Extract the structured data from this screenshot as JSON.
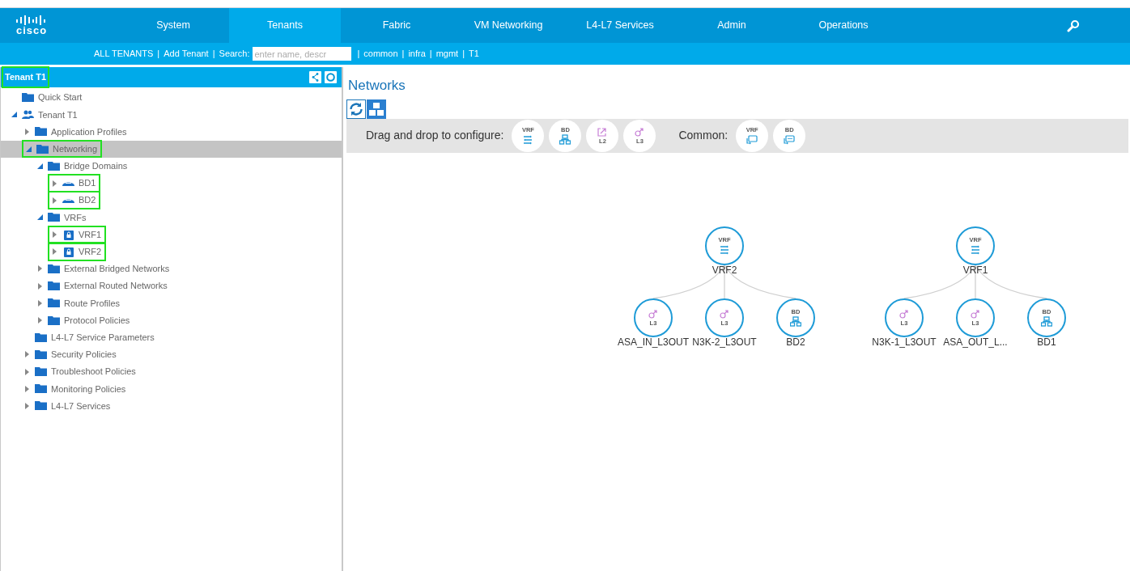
{
  "top_nav": {
    "logo": "cisco",
    "tabs": [
      {
        "label": "System",
        "selected": false
      },
      {
        "label": "Tenants",
        "selected": true
      },
      {
        "label": "Fabric",
        "selected": false
      },
      {
        "label": "VM Networking",
        "selected": false
      },
      {
        "label": "L4-L7 Services",
        "selected": false
      },
      {
        "label": "Admin",
        "selected": false
      },
      {
        "label": "Operations",
        "selected": false
      }
    ]
  },
  "sub_nav": {
    "before": [
      {
        "kind": "link",
        "text": "ALL TENANTS"
      },
      {
        "kind": "sep",
        "text": "|"
      },
      {
        "kind": "link",
        "text": "Add Tenant"
      },
      {
        "kind": "sep",
        "text": "|"
      },
      {
        "kind": "label",
        "text": "Search:"
      }
    ],
    "search": {
      "placeholder": "enter name, descr"
    },
    "after": [
      {
        "kind": "sep",
        "text": "|"
      },
      {
        "kind": "link",
        "text": "common"
      },
      {
        "kind": "sep",
        "text": "|"
      },
      {
        "kind": "link",
        "text": "infra"
      },
      {
        "kind": "sep",
        "text": "|"
      },
      {
        "kind": "link",
        "text": "mgmt"
      },
      {
        "kind": "sep",
        "text": "|"
      },
      {
        "kind": "link",
        "text": "T1"
      }
    ]
  },
  "sidebar": {
    "title": "Tenant T1",
    "title_highlighted": true,
    "tree": [
      {
        "label": "Quick Start",
        "kind": "folder",
        "selected": false,
        "highlighted": false
      },
      {
        "label": "Tenant T1",
        "kind": "tenant",
        "expanded": true,
        "selected": false,
        "highlighted": false,
        "children": [
          {
            "label": "Application Profiles",
            "kind": "folder",
            "expanded": false,
            "selected": false,
            "highlighted": false
          },
          {
            "label": "Networking",
            "kind": "folder",
            "expanded": true,
            "selected": true,
            "highlighted": true,
            "children": [
              {
                "label": "Bridge Domains",
                "kind": "folder",
                "expanded": true,
                "selected": false,
                "highlighted": false,
                "children": [
                  {
                    "label": "BD1",
                    "kind": "bd",
                    "expanded": false,
                    "selected": false,
                    "highlighted": true
                  },
                  {
                    "label": "BD2",
                    "kind": "bd",
                    "expanded": false,
                    "selected": false,
                    "highlighted": true
                  }
                ]
              },
              {
                "label": "VRFs",
                "kind": "folder",
                "expanded": true,
                "selected": false,
                "highlighted": false,
                "children": [
                  {
                    "label": "VRF1",
                    "kind": "vrf",
                    "expanded": false,
                    "selected": false,
                    "highlighted": true
                  },
                  {
                    "label": "VRF2",
                    "kind": "vrf",
                    "expanded": false,
                    "selected": false,
                    "highlighted": true
                  }
                ]
              },
              {
                "label": "External Bridged Networks",
                "kind": "folder",
                "expanded": false,
                "selected": false,
                "highlighted": false
              },
              {
                "label": "External Routed Networks",
                "kind": "folder",
                "expanded": false,
                "selected": false,
                "highlighted": false
              },
              {
                "label": "Route Profiles",
                "kind": "folder",
                "expanded": false,
                "selected": false,
                "highlighted": false
              },
              {
                "label": "Protocol Policies",
                "kind": "folder",
                "expanded": false,
                "selected": false,
                "highlighted": false
              }
            ]
          },
          {
            "label": "L4-L7 Service Parameters",
            "kind": "folder",
            "selected": false,
            "highlighted": false
          },
          {
            "label": "Security Policies",
            "kind": "folder",
            "expanded": false,
            "selected": false,
            "highlighted": false
          },
          {
            "label": "Troubleshoot Policies",
            "kind": "folder",
            "expanded": false,
            "selected": false,
            "highlighted": false
          },
          {
            "label": "Monitoring Policies",
            "kind": "folder",
            "expanded": false,
            "selected": false,
            "highlighted": false
          },
          {
            "label": "L4-L7 Services",
            "kind": "folder",
            "expanded": false,
            "selected": false,
            "highlighted": false
          }
        ]
      }
    ]
  },
  "main": {
    "title": "Networks",
    "palette": {
      "label": "Drag and drop to configure:",
      "items": [
        {
          "kind": "vrf",
          "text": "VRF"
        },
        {
          "kind": "bd",
          "text": "BD"
        },
        {
          "kind": "l2",
          "text": "L2"
        },
        {
          "kind": "l3",
          "text": "L3"
        }
      ],
      "common_label": "Common:",
      "common_items": [
        {
          "kind": "vrf-common",
          "text": "VRF"
        },
        {
          "kind": "bd-common",
          "text": "BD"
        }
      ]
    },
    "graph": [
      {
        "root": {
          "kind": "vrf",
          "text": "VRF",
          "name": "VRF2"
        },
        "children": [
          {
            "kind": "l3",
            "text": "L3",
            "name": "ASA_IN_L3OUT"
          },
          {
            "kind": "l3",
            "text": "L3",
            "name": "N3K-2_L3OUT"
          },
          {
            "kind": "bd",
            "text": "BD",
            "name": "BD2"
          }
        ]
      },
      {
        "root": {
          "kind": "vrf",
          "text": "VRF",
          "name": "VRF1"
        },
        "children": [
          {
            "kind": "l3",
            "text": "L3",
            "name": "N3K-1_L3OUT"
          },
          {
            "kind": "l3",
            "text": "L3",
            "name": "ASA_OUT_L..."
          },
          {
            "kind": "bd",
            "text": "BD",
            "name": "BD1"
          }
        ]
      }
    ]
  }
}
